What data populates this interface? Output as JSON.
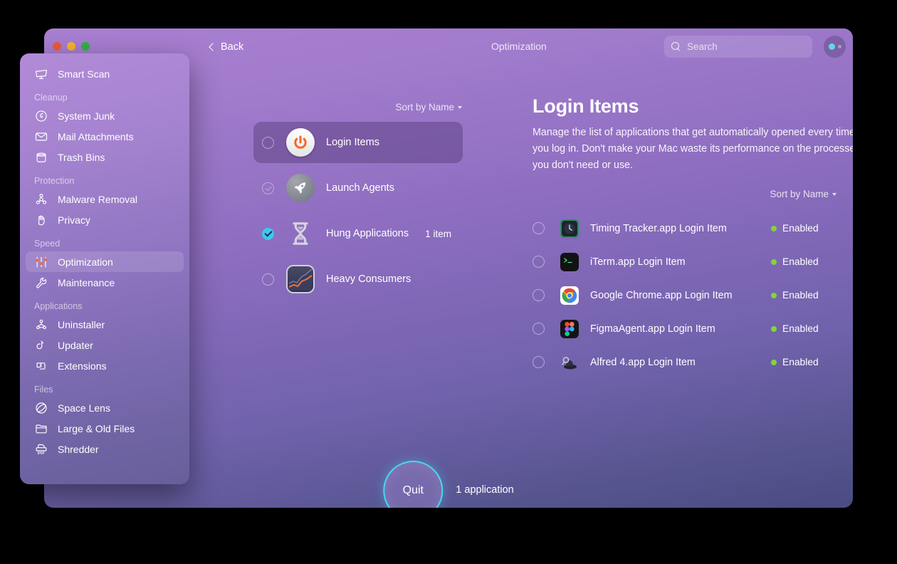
{
  "window": {
    "title": "Optimization",
    "back_label": "Back",
    "traffic_lights": [
      "close-red",
      "minimize-yellow",
      "zoom-green"
    ],
    "accent_cyan": "#3ec7ef",
    "status_green": "#84d438"
  },
  "search": {
    "placeholder": "Search",
    "value": "",
    "icon": "search-icon"
  },
  "account": {
    "icon": "account-status-icon"
  },
  "sidebar": {
    "groups": [
      {
        "label": "",
        "items": [
          {
            "label": "Smart Scan",
            "icon": "smart-scan-icon",
            "active": false
          }
        ]
      },
      {
        "label": "Cleanup",
        "items": [
          {
            "label": "System Junk",
            "icon": "system-junk-icon",
            "active": false
          },
          {
            "label": "Mail Attachments",
            "icon": "mail-attachments-icon",
            "active": false
          },
          {
            "label": "Trash Bins",
            "icon": "trash-bins-icon",
            "active": false
          }
        ]
      },
      {
        "label": "Protection",
        "items": [
          {
            "label": "Malware Removal",
            "icon": "malware-removal-icon",
            "active": false
          },
          {
            "label": "Privacy",
            "icon": "privacy-icon",
            "active": false
          }
        ]
      },
      {
        "label": "Speed",
        "items": [
          {
            "label": "Optimization",
            "icon": "optimization-icon",
            "active": true
          },
          {
            "label": "Maintenance",
            "icon": "maintenance-icon",
            "active": false
          }
        ]
      },
      {
        "label": "Applications",
        "items": [
          {
            "label": "Uninstaller",
            "icon": "uninstaller-icon",
            "active": false
          },
          {
            "label": "Updater",
            "icon": "updater-icon",
            "active": false
          },
          {
            "label": "Extensions",
            "icon": "extensions-icon",
            "active": false
          }
        ]
      },
      {
        "label": "Files",
        "items": [
          {
            "label": "Space Lens",
            "icon": "space-lens-icon",
            "active": false
          },
          {
            "label": "Large & Old Files",
            "icon": "large-old-files-icon",
            "active": false
          },
          {
            "label": "Shredder",
            "icon": "shredder-icon",
            "active": false
          }
        ]
      }
    ]
  },
  "middle": {
    "sort_label": "Sort by Name",
    "rows": [
      {
        "label": "Login Items",
        "icon": "power-button-icon",
        "check": "empty",
        "count": "",
        "selected": true
      },
      {
        "label": "Launch Agents",
        "icon": "rocket-icon",
        "check": "faint",
        "count": "",
        "selected": false
      },
      {
        "label": "Hung Applications",
        "icon": "hourglass-icon",
        "check": "checked",
        "count": "1 item",
        "selected": false
      },
      {
        "label": "Heavy Consumers",
        "icon": "activity-monitor-icon",
        "check": "empty",
        "count": "",
        "selected": false
      }
    ]
  },
  "detail": {
    "title": "Login Items",
    "description": "Manage the list of applications that get automatically opened every time you log in. Don't make your Mac waste its performance on the processes you don't need or use.",
    "sort_label": "Sort by Name",
    "items": [
      {
        "name": "Timing Tracker.app Login Item",
        "icon": "timing-tracker-app-icon",
        "status": "Enabled",
        "check": "empty"
      },
      {
        "name": "iTerm.app Login Item",
        "icon": "iterm-app-icon",
        "status": "Enabled",
        "check": "empty"
      },
      {
        "name": "Google Chrome.app Login Item",
        "icon": "google-chrome-app-icon",
        "status": "Enabled",
        "check": "empty"
      },
      {
        "name": "FigmaAgent.app Login Item",
        "icon": "figma-agent-app-icon",
        "status": "Enabled",
        "check": "empty"
      },
      {
        "name": "Alfred 4.app Login Item",
        "icon": "alfred-app-icon",
        "status": "Enabled",
        "check": "empty"
      }
    ]
  },
  "footer": {
    "quit_label": "Quit",
    "count_label": "1 application"
  }
}
